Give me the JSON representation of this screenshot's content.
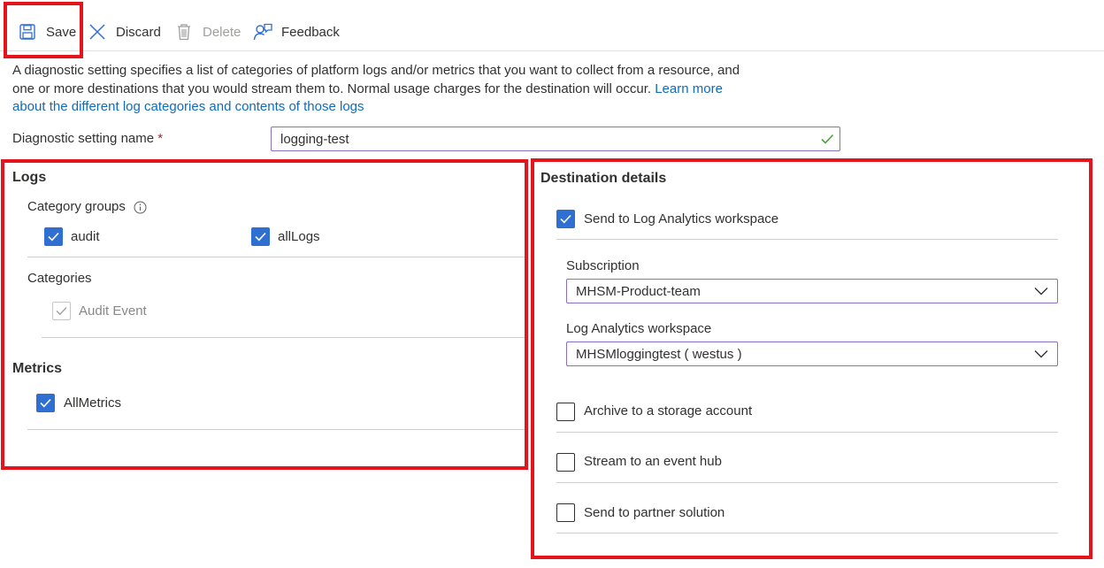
{
  "toolbar": {
    "save": "Save",
    "discard": "Discard",
    "delete": "Delete",
    "feedback": "Feedback"
  },
  "description": {
    "text": "A diagnostic setting specifies a list of categories of platform logs and/or metrics that you want to collect from a resource, and one or more destinations that you would stream them to. Normal usage charges for the destination will occur.",
    "link": "Learn more about the different log categories and contents of those logs"
  },
  "setting_name": {
    "label": "Diagnostic setting name",
    "required_mark": "*",
    "value": "logging-test"
  },
  "logs": {
    "heading": "Logs",
    "category_groups_label": "Category groups",
    "groups": [
      {
        "label": "audit",
        "checked": true
      },
      {
        "label": "allLogs",
        "checked": true
      }
    ],
    "categories_label": "Categories",
    "categories": [
      {
        "label": "Audit Event",
        "checked": true,
        "disabled": true
      }
    ]
  },
  "metrics": {
    "heading": "Metrics",
    "items": [
      {
        "label": "AllMetrics",
        "checked": true
      }
    ]
  },
  "destination": {
    "heading": "Destination details",
    "log_analytics": {
      "label": "Send to Log Analytics workspace",
      "checked": true
    },
    "subscription": {
      "label": "Subscription",
      "value": "MHSM-Product-team"
    },
    "workspace": {
      "label": "Log Analytics workspace",
      "value": "MHSMloggingtest ( westus )"
    },
    "storage": {
      "label": "Archive to a storage account",
      "checked": false
    },
    "event_hub": {
      "label": "Stream to an event hub",
      "checked": false
    },
    "partner": {
      "label": "Send to partner solution",
      "checked": false
    }
  },
  "colors": {
    "accent": "#2f6fd2",
    "highlight": "#e3141b",
    "link": "#0f6cbd",
    "input_border": "#8a6fbf",
    "valid_check": "#4ba33a"
  }
}
